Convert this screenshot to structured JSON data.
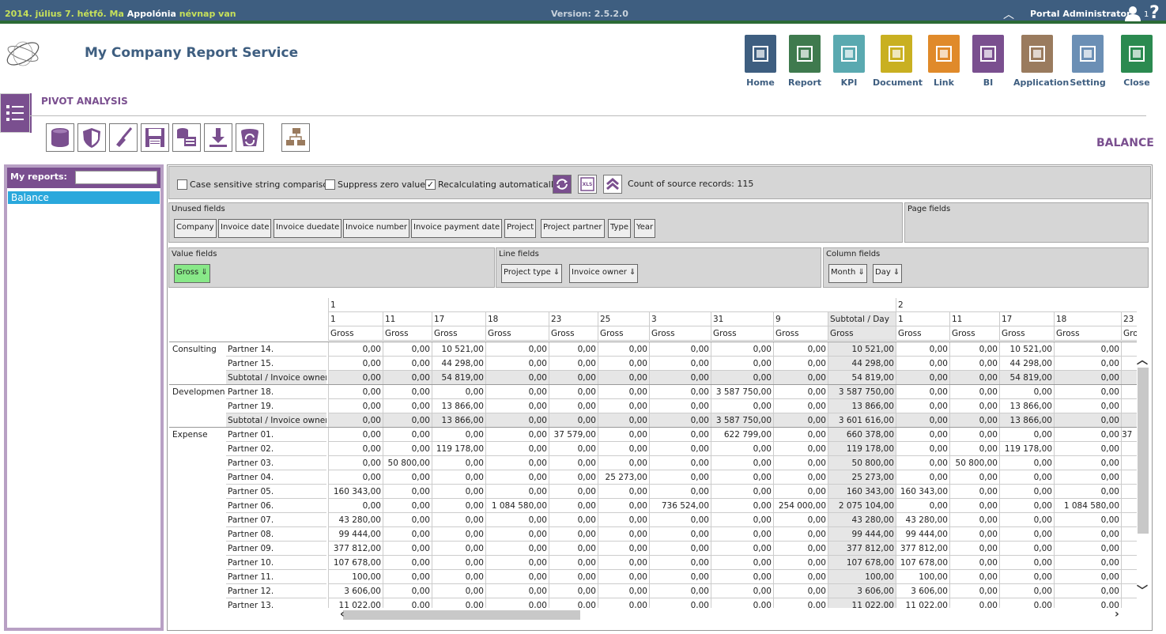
{
  "topbar": {
    "date_part": "2014. július 7. hétfő. Ma",
    "name": "Appolónia",
    "nameday": "névnap van",
    "version": "Version: 2.5.2.0",
    "user": "Portal Administrator",
    "user_count": "1",
    "help": "?"
  },
  "app": {
    "title": "My Company Report Service"
  },
  "nav": [
    {
      "label": "Home",
      "icon": "home-icon",
      "color": "#3e5e80"
    },
    {
      "label": "Report",
      "icon": "report-icon",
      "color": "#3f7a4e"
    },
    {
      "label": "KPI",
      "icon": "kpi-icon",
      "color": "#5aa9b0"
    },
    {
      "label": "Document",
      "icon": "document-icon",
      "color": "#c9b021"
    },
    {
      "label": "Link",
      "icon": "link-icon",
      "color": "#e08a2a"
    },
    {
      "label": "BI",
      "icon": "bi-icon",
      "color": "#7a4f8f"
    },
    {
      "label": "Application",
      "icon": "application-icon",
      "color": "#9a7b5e"
    },
    {
      "label": "Setting",
      "icon": "setting-icon",
      "color": "#6b8fb5"
    },
    {
      "label": "Close",
      "icon": "close-icon",
      "color": "#2b8a50"
    }
  ],
  "section": {
    "title": "PIVOT ANALYSIS",
    "report_title": "BALANCE"
  },
  "toolbar": [
    "database-icon",
    "shield-icon",
    "broom-icon",
    "save-icon",
    "export-db-icon",
    "download-icon",
    "refresh-bin-icon",
    "hierarchy-icon"
  ],
  "sidebar": {
    "header": "My reports:",
    "search_value": "",
    "items": [
      "Balance"
    ]
  },
  "options": {
    "case_sensitive": "Case sensitive string comparison",
    "suppress_zero": "Suppress zero values",
    "recalc": "Recalculating automatically",
    "recalc_checked": true,
    "count_label": "Count of source records: 115"
  },
  "zones": {
    "unused_title": "Unused fields",
    "unused": [
      "Company",
      "Invoice date",
      "Invoice duedate",
      "Invoice number",
      "Invoice payment date",
      "Project",
      "Project partner",
      "Type",
      "Year"
    ],
    "page_title": "Page fields",
    "value_title": "Value fields",
    "value": [
      "Gross ⇓"
    ],
    "line_title": "Line fields",
    "line": [
      "Project type ⇓",
      "Invoice owner ⇓"
    ],
    "column_title": "Column fields",
    "column": [
      "Month ⇓",
      "Day ⇓"
    ]
  },
  "pivot": {
    "month_headers": [
      "1",
      "2"
    ],
    "day_headers": [
      "1",
      "11",
      "17",
      "18",
      "23",
      "25",
      "3",
      "31",
      "9",
      "Subtotal / Day",
      "1",
      "11",
      "17",
      "18",
      "23"
    ],
    "measure": "Gross",
    "groups": [
      {
        "name": "Consulting",
        "rows": [
          {
            "label": "Partner 14.",
            "values": [
              "0,00",
              "0,00",
              "10 521,00",
              "0,00",
              "0,00",
              "0,00",
              "0,00",
              "0,00",
              "0,00",
              "10 521,00",
              "0,00",
              "0,00",
              "10 521,00",
              "0,00",
              ""
            ]
          },
          {
            "label": "Partner 15.",
            "values": [
              "0,00",
              "0,00",
              "44 298,00",
              "0,00",
              "0,00",
              "0,00",
              "0,00",
              "0,00",
              "0,00",
              "44 298,00",
              "0,00",
              "0,00",
              "44 298,00",
              "0,00",
              ""
            ]
          },
          {
            "label": "Subtotal / Invoice owner",
            "sub": true,
            "values": [
              "0,00",
              "0,00",
              "54 819,00",
              "0,00",
              "0,00",
              "0,00",
              "0,00",
              "0,00",
              "0,00",
              "54 819,00",
              "0,00",
              "0,00",
              "54 819,00",
              "0,00",
              ""
            ]
          }
        ]
      },
      {
        "name": "Development",
        "rows": [
          {
            "label": "Partner 18.",
            "values": [
              "0,00",
              "0,00",
              "0,00",
              "0,00",
              "0,00",
              "0,00",
              "0,00",
              "3 587 750,00",
              "0,00",
              "3 587 750,00",
              "0,00",
              "0,00",
              "0,00",
              "0,00",
              ""
            ]
          },
          {
            "label": "Partner 19.",
            "values": [
              "0,00",
              "0,00",
              "13 866,00",
              "0,00",
              "0,00",
              "0,00",
              "0,00",
              "0,00",
              "0,00",
              "13 866,00",
              "0,00",
              "0,00",
              "13 866,00",
              "0,00",
              ""
            ]
          },
          {
            "label": "Subtotal / Invoice owner",
            "sub": true,
            "values": [
              "0,00",
              "0,00",
              "13 866,00",
              "0,00",
              "0,00",
              "0,00",
              "0,00",
              "3 587 750,00",
              "0,00",
              "3 601 616,00",
              "0,00",
              "0,00",
              "13 866,00",
              "0,00",
              ""
            ]
          }
        ]
      },
      {
        "name": "Expense",
        "rows": [
          {
            "label": "Partner 01.",
            "values": [
              "0,00",
              "0,00",
              "0,00",
              "0,00",
              "37 579,00",
              "0,00",
              "0,00",
              "622 799,00",
              "0,00",
              "660 378,00",
              "0,00",
              "0,00",
              "0,00",
              "0,00",
              "37"
            ]
          },
          {
            "label": "Partner 02.",
            "values": [
              "0,00",
              "0,00",
              "119 178,00",
              "0,00",
              "0,00",
              "0,00",
              "0,00",
              "0,00",
              "0,00",
              "119 178,00",
              "0,00",
              "0,00",
              "119 178,00",
              "0,00",
              ""
            ]
          },
          {
            "label": "Partner 03.",
            "values": [
              "0,00",
              "50 800,00",
              "0,00",
              "0,00",
              "0,00",
              "0,00",
              "0,00",
              "0,00",
              "0,00",
              "50 800,00",
              "0,00",
              "50 800,00",
              "0,00",
              "0,00",
              ""
            ]
          },
          {
            "label": "Partner 04.",
            "values": [
              "0,00",
              "0,00",
              "0,00",
              "0,00",
              "0,00",
              "25 273,00",
              "0,00",
              "0,00",
              "0,00",
              "25 273,00",
              "0,00",
              "0,00",
              "0,00",
              "0,00",
              ""
            ]
          },
          {
            "label": "Partner 05.",
            "values": [
              "160 343,00",
              "0,00",
              "0,00",
              "0,00",
              "0,00",
              "0,00",
              "0,00",
              "0,00",
              "0,00",
              "160 343,00",
              "160 343,00",
              "0,00",
              "0,00",
              "0,00",
              ""
            ]
          },
          {
            "label": "Partner 06.",
            "values": [
              "0,00",
              "0,00",
              "0,00",
              "1 084 580,00",
              "0,00",
              "0,00",
              "736 524,00",
              "0,00",
              "254 000,00",
              "2 075 104,00",
              "0,00",
              "0,00",
              "0,00",
              "1 084 580,00",
              ""
            ]
          },
          {
            "label": "Partner 07.",
            "values": [
              "43 280,00",
              "0,00",
              "0,00",
              "0,00",
              "0,00",
              "0,00",
              "0,00",
              "0,00",
              "0,00",
              "43 280,00",
              "43 280,00",
              "0,00",
              "0,00",
              "0,00",
              ""
            ]
          },
          {
            "label": "Partner 08.",
            "values": [
              "99 444,00",
              "0,00",
              "0,00",
              "0,00",
              "0,00",
              "0,00",
              "0,00",
              "0,00",
              "0,00",
              "99 444,00",
              "99 444,00",
              "0,00",
              "0,00",
              "0,00",
              ""
            ]
          },
          {
            "label": "Partner 09.",
            "values": [
              "377 812,00",
              "0,00",
              "0,00",
              "0,00",
              "0,00",
              "0,00",
              "0,00",
              "0,00",
              "0,00",
              "377 812,00",
              "377 812,00",
              "0,00",
              "0,00",
              "0,00",
              ""
            ]
          },
          {
            "label": "Partner 10.",
            "values": [
              "107 678,00",
              "0,00",
              "0,00",
              "0,00",
              "0,00",
              "0,00",
              "0,00",
              "0,00",
              "0,00",
              "107 678,00",
              "107 678,00",
              "0,00",
              "0,00",
              "0,00",
              ""
            ]
          },
          {
            "label": "Partner 11.",
            "values": [
              "100,00",
              "0,00",
              "0,00",
              "0,00",
              "0,00",
              "0,00",
              "0,00",
              "0,00",
              "0,00",
              "100,00",
              "100,00",
              "0,00",
              "0,00",
              "0,00",
              ""
            ]
          },
          {
            "label": "Partner 12.",
            "values": [
              "3 606,00",
              "0,00",
              "0,00",
              "0,00",
              "0,00",
              "0,00",
              "0,00",
              "0,00",
              "0,00",
              "3 606,00",
              "3 606,00",
              "0,00",
              "0,00",
              "0,00",
              ""
            ]
          },
          {
            "label": "Partner 13.",
            "values": [
              "11 022,00",
              "0,00",
              "0,00",
              "0,00",
              "0,00",
              "0,00",
              "0,00",
              "0,00",
              "0,00",
              "11 022,00",
              "11 022,00",
              "0,00",
              "0,00",
              "0,00",
              ""
            ]
          }
        ]
      }
    ]
  }
}
